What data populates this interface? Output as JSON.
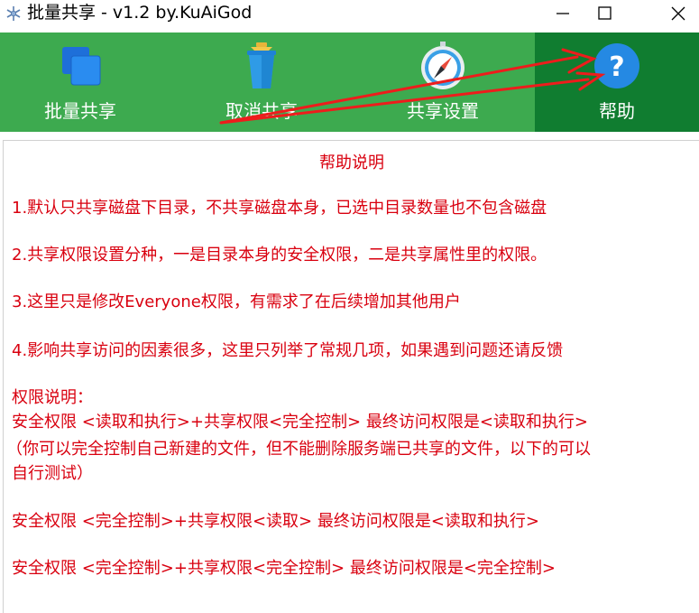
{
  "window": {
    "title": "批量共享 - v1.2 by.KuAiGod",
    "icon": "snowflake-icon"
  },
  "toolbar": {
    "colors": {
      "bg": "#3daa4f",
      "active_bg": "#107d30"
    },
    "items": [
      {
        "label": "批量共享",
        "icon": "windows-stack-icon",
        "active": false
      },
      {
        "label": "取消共享",
        "icon": "trash-can-icon",
        "active": false
      },
      {
        "label": "共享设置",
        "icon": "compass-icon",
        "active": false
      },
      {
        "label": "帮助",
        "icon": "help-question-icon",
        "active": true
      }
    ]
  },
  "help": {
    "title": "帮助说明",
    "items": [
      "1.默认只共享磁盘下目录，不共享磁盘本身，已选中目录数量也不包含磁盘",
      "2.共享权限设置分种，一是目录本身的安全权限，二是共享属性里的权限。",
      "3.这里只是修改Everyone权限，有需求了在后续增加其他用户",
      "4.影响共享访问的因素很多，这里只列举了常规几项，如果遇到问题还请反馈"
    ],
    "permissions_heading": "权限说明：",
    "permission_line1": "安全权限 <读取和执行>+共享权限<完全控制> 最终访问权限是<读取和执行>",
    "permission_note_a": "（你可以完全控制自己新建的文件，但不能删除服务端已共享的文件，以下的可以",
    "permission_note_b": "自行测试）",
    "permission_line2": "安全权限 <完全控制>+共享权限<读取> 最终访问权限是<读取和执行>",
    "permission_line3": "安全权限 <完全控制>+共享权限<完全控制> 最终访问权限是<完全控制>",
    "text_color": "#d9000f"
  }
}
